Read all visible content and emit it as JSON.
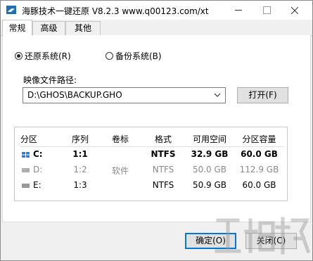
{
  "window": {
    "title": "海豚技术一键还原 V8.2.3 www.q00123.com/xt"
  },
  "tabs": [
    {
      "label": "常规",
      "active": true
    },
    {
      "label": "高级",
      "active": false
    },
    {
      "label": "其他",
      "active": false
    }
  ],
  "mode": {
    "restore_label": "还原系统(R)",
    "backup_label": "备份系统(B)",
    "selected": "restore"
  },
  "image_path": {
    "label": "映像文件路径:",
    "value": "D:\\GHOS\\BACKUP.GHO",
    "open_button": "打开(F)"
  },
  "partitions": {
    "headers": [
      "分区",
      "序列",
      "卷标",
      "格式",
      "可用空间",
      "分区容量"
    ],
    "rows": [
      {
        "drive": "C:",
        "seq": "1:1",
        "label": "",
        "format": "NTFS",
        "free": "32.9 GB",
        "capacity": "60.0 GB",
        "icon": "windows-drive-icon",
        "selected": true
      },
      {
        "drive": "D:",
        "seq": "1:2",
        "label": "软件",
        "format": "NTFS",
        "free": "50.0 GB",
        "capacity": "112.9 GB",
        "icon": "drive-icon",
        "dimmed": true
      },
      {
        "drive": "E:",
        "seq": "1:3",
        "label": "",
        "format": "NTFS",
        "free": "50.9 GB",
        "capacity": "60.0 GB",
        "icon": "drive-icon"
      }
    ]
  },
  "footer": {
    "ok_button": "确定(O)",
    "close_button": "关闭(C)"
  },
  "colors": {
    "accent": "#0078d7",
    "dim_text": "#8a8a8a"
  }
}
